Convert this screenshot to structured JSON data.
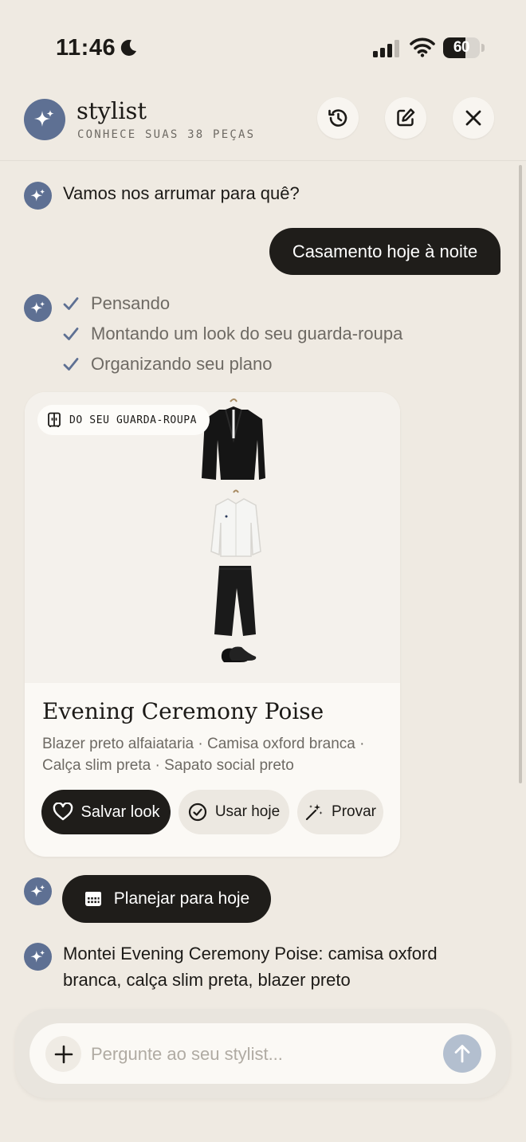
{
  "status_bar": {
    "time": "11:46",
    "battery": "60",
    "battery_level": 0.6
  },
  "header": {
    "title": "stylist",
    "subtitle": "CONHECE SUAS 38 PEÇAS"
  },
  "chat": {
    "assistant_greeting": "Vamos nos arrumar para quê?",
    "user_message": "Casamento hoje à noite",
    "steps": [
      "Pensando",
      "Montando um look do seu guarda-roupa",
      "Organizando seu plano"
    ],
    "outfit_card": {
      "badge": "DO SEU GUARDA-ROUPA",
      "title": "Evening Ceremony Poise",
      "description": "Blazer preto alfaiataria · Camisa oxford branca · Calça slim preta · Sapato social preto",
      "actions": {
        "save": "Salvar look",
        "use_today": "Usar hoje",
        "try_on": "Provar"
      }
    },
    "plan_button": "Planejar para hoje",
    "assistant_summary": "Montei Evening Ceremony Poise: camisa oxford branca, calça slim preta, blazer preto"
  },
  "composer": {
    "placeholder": "Pergunte ao seu stylist..."
  },
  "colors": {
    "accent": "#5e7093",
    "dark": "#1f1d1a",
    "background": "#efeae2"
  }
}
